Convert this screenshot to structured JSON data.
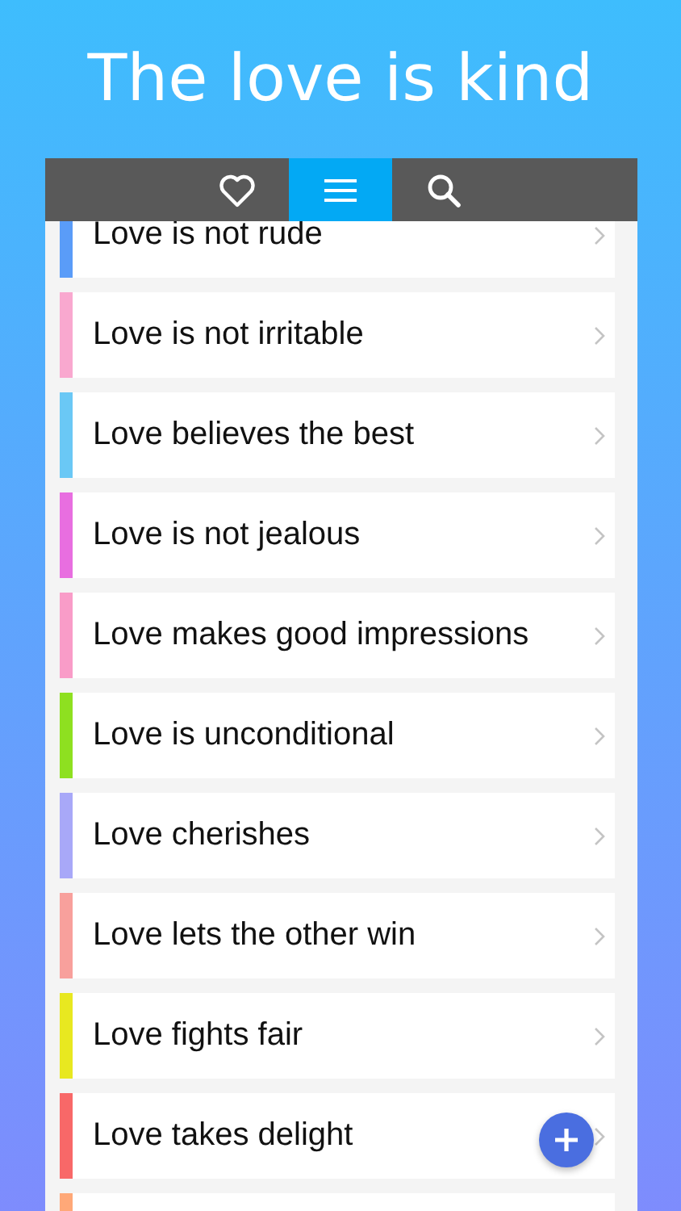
{
  "title": "The love is kind",
  "tabs": [
    {
      "kind": "heart",
      "selected": false
    },
    {
      "kind": "menu",
      "selected": true
    },
    {
      "kind": "search",
      "selected": false
    }
  ],
  "items": [
    {
      "label": "Love is not rude",
      "color": "#5a9cf8"
    },
    {
      "label": "Love is not irritable",
      "color": "#f9a8cf"
    },
    {
      "label": "Love believes the best",
      "color": "#6ac8f5"
    },
    {
      "label": "Love is not jealous",
      "color": "#e86ee0"
    },
    {
      "label": "Love makes good impressions",
      "color": "#f99cc8"
    },
    {
      "label": "Love is unconditional",
      "color": "#8ee020"
    },
    {
      "label": "Love cherishes",
      "color": "#a8a8f8"
    },
    {
      "label": "Love lets the other win",
      "color": "#f8a09c"
    },
    {
      "label": "Love fights fair",
      "color": "#e8e820"
    },
    {
      "label": "Love takes delight",
      "color": "#f86868"
    },
    {
      "color": "#ffa878"
    }
  ]
}
